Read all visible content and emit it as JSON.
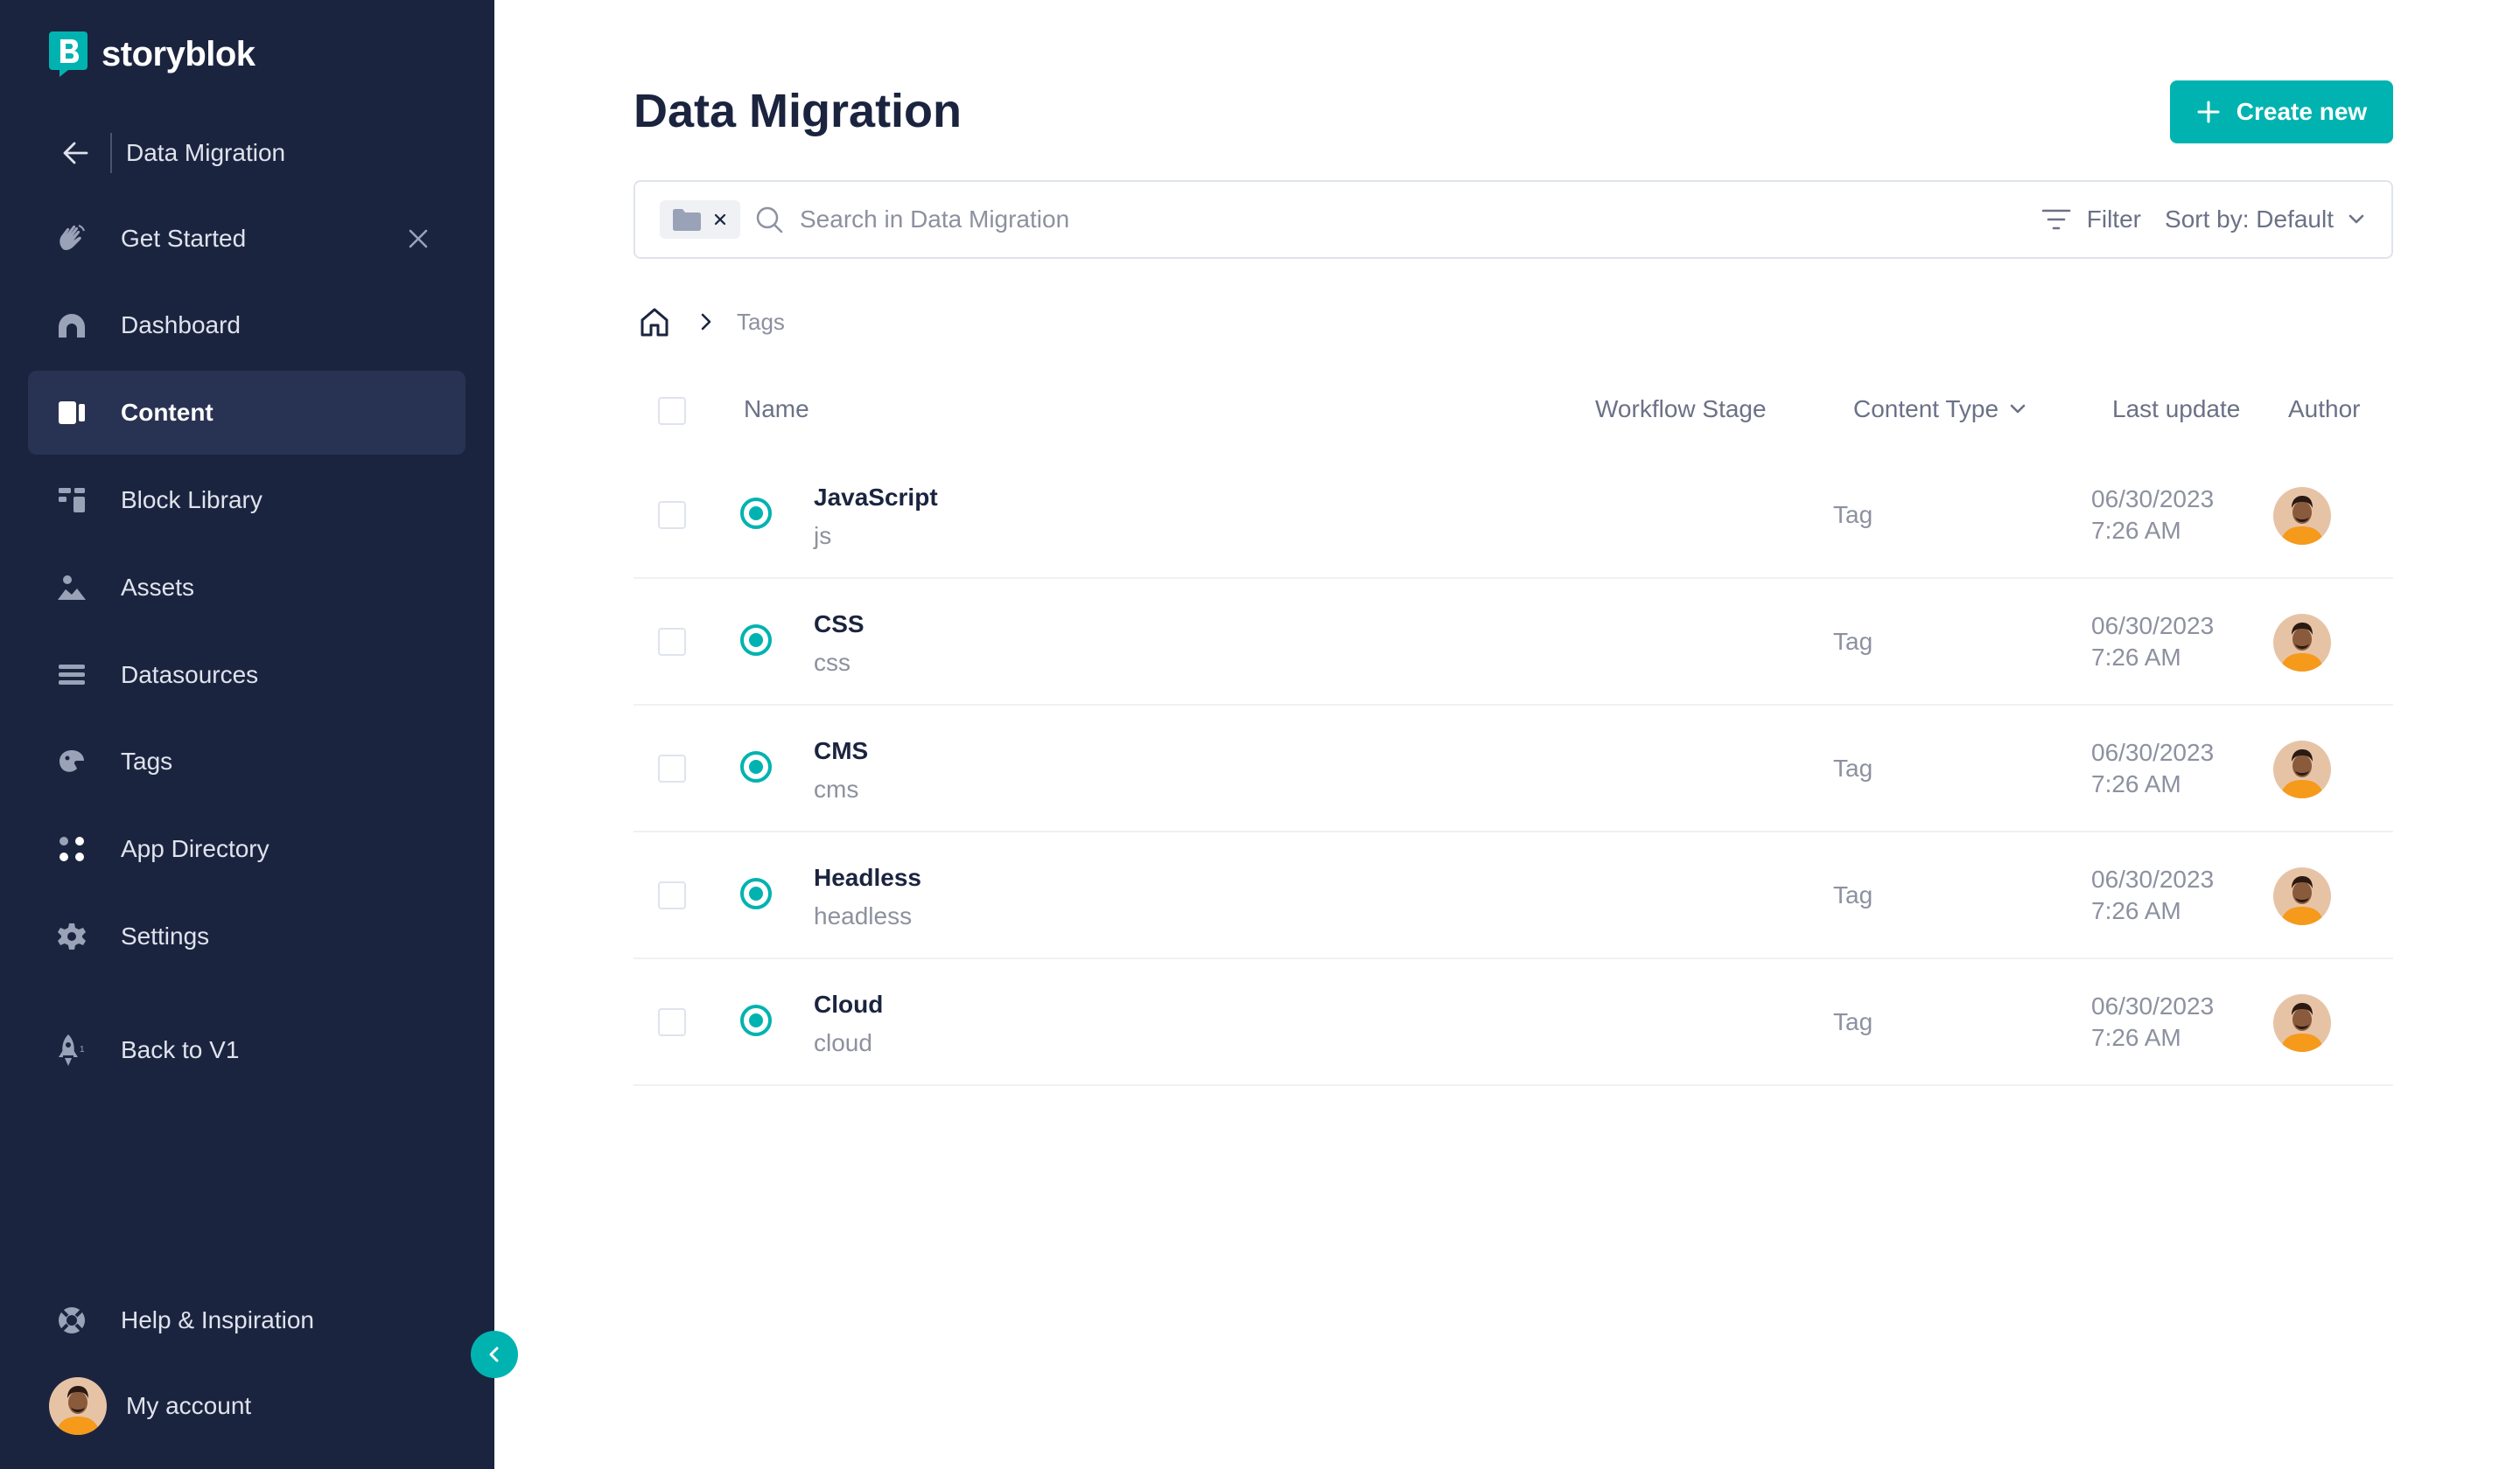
{
  "brand": {
    "name": "storyblok",
    "accent": "#00b3b0",
    "sidebar_bg": "#1b243f"
  },
  "space": {
    "name": "Data Migration",
    "back_icon": "arrow-left-icon"
  },
  "sidebar": {
    "items": [
      {
        "id": "get-started",
        "label": "Get Started",
        "icon": "hand-wave-icon",
        "closable": true
      },
      {
        "id": "dashboard",
        "label": "Dashboard",
        "icon": "dashboard-icon"
      },
      {
        "id": "content",
        "label": "Content",
        "icon": "content-icon",
        "active": true
      },
      {
        "id": "block-library",
        "label": "Block Library",
        "icon": "blocks-icon"
      },
      {
        "id": "assets",
        "label": "Assets",
        "icon": "assets-icon"
      },
      {
        "id": "datasources",
        "label": "Datasources",
        "icon": "datasources-icon"
      },
      {
        "id": "tags",
        "label": "Tags",
        "icon": "tag-icon"
      },
      {
        "id": "app-directory",
        "label": "App Directory",
        "icon": "apps-icon"
      },
      {
        "id": "settings",
        "label": "Settings",
        "icon": "gear-icon"
      },
      {
        "id": "back-to-v1",
        "label": "Back to V1",
        "icon": "rocket-icon"
      }
    ],
    "help_label": "Help & Inspiration",
    "account_label": "My account"
  },
  "main": {
    "title": "Data Migration",
    "create_label": "Create new",
    "search": {
      "placeholder": "Search in Data Migration",
      "value": ""
    },
    "filter_label": "Filter",
    "sort_label": "Sort by: Default",
    "breadcrumb": {
      "current": "Tags"
    }
  },
  "table": {
    "headers": {
      "name": "Name",
      "workflow": "Workflow Stage",
      "content_type": "Content Type",
      "last_update": "Last update",
      "author": "Author"
    },
    "rows": [
      {
        "name": "JavaScript",
        "slug": "js",
        "content_type": "Tag",
        "date": "06/30/2023",
        "time": "7:26 AM"
      },
      {
        "name": "CSS",
        "slug": "css",
        "content_type": "Tag",
        "date": "06/30/2023",
        "time": "7:26 AM"
      },
      {
        "name": "CMS",
        "slug": "cms",
        "content_type": "Tag",
        "date": "06/30/2023",
        "time": "7:26 AM"
      },
      {
        "name": "Headless",
        "slug": "headless",
        "content_type": "Tag",
        "date": "06/30/2023",
        "time": "7:26 AM"
      },
      {
        "name": "Cloud",
        "slug": "cloud",
        "content_type": "Tag",
        "date": "06/30/2023",
        "time": "7:26 AM"
      }
    ]
  }
}
